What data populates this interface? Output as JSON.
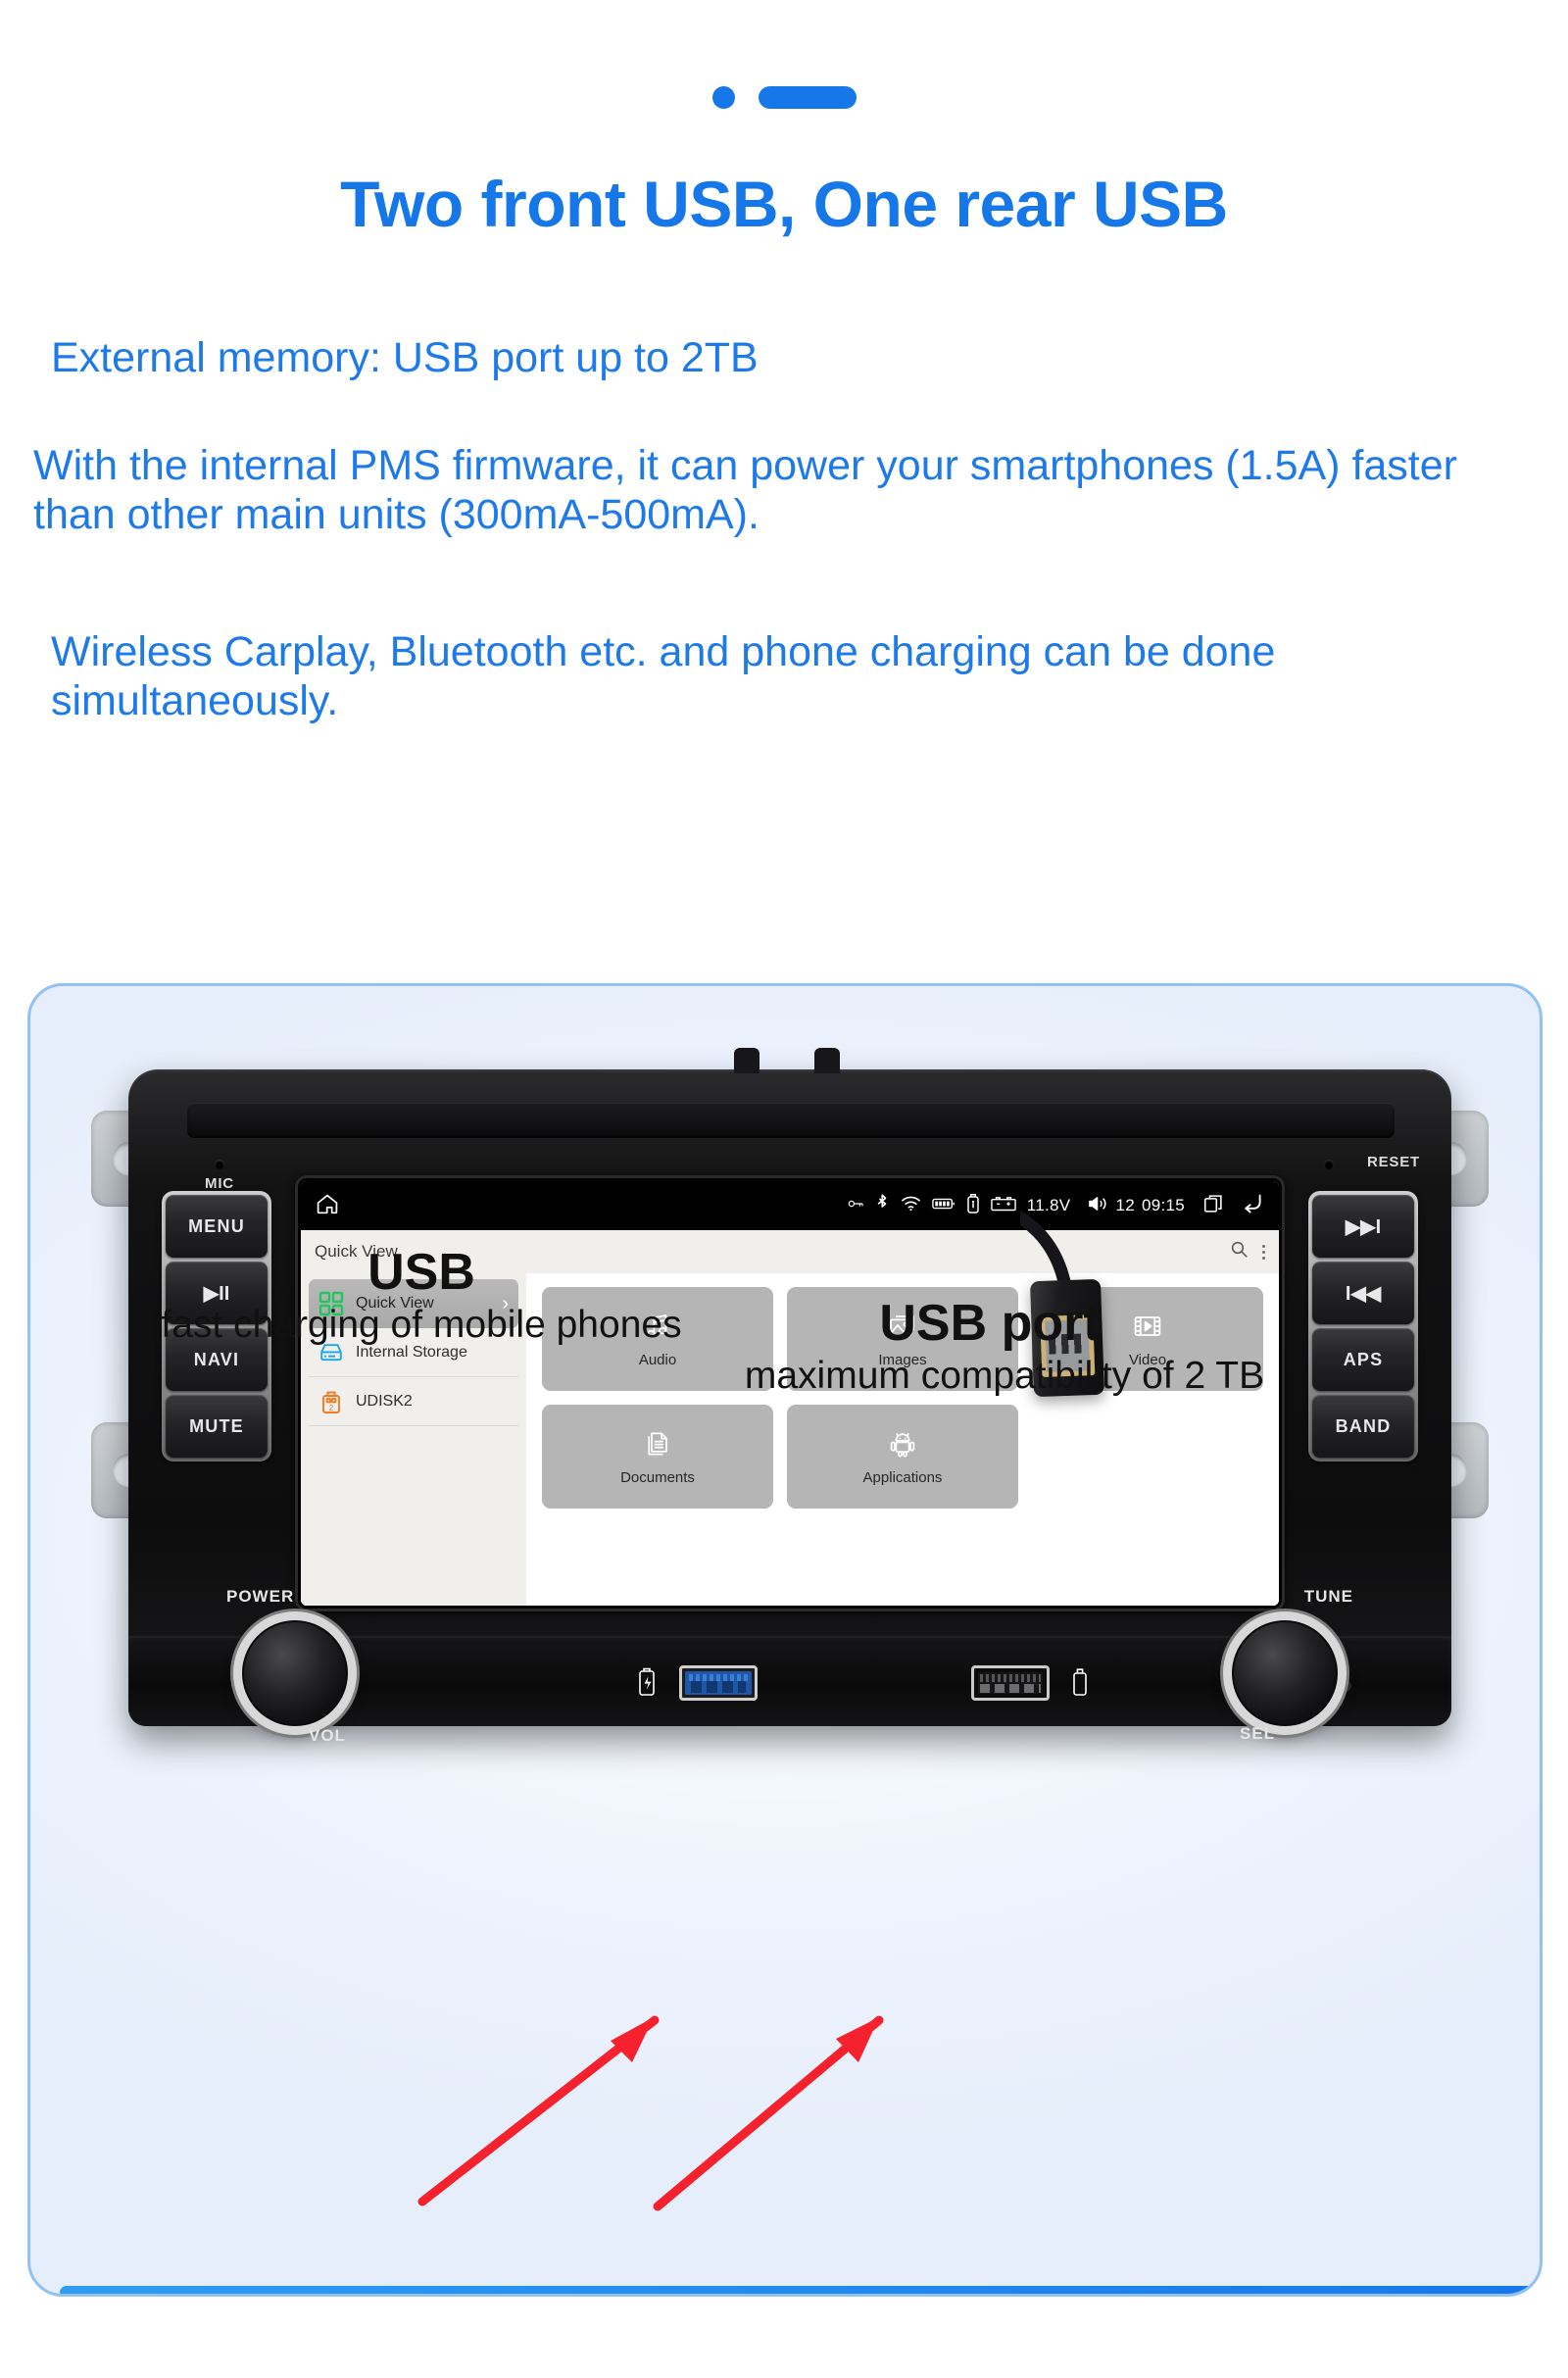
{
  "decoration": {
    "dot": "blue-dot",
    "bar": "blue-bar"
  },
  "headline": "Two front USB, One rear USB",
  "paragraphs": {
    "p1": "External memory: USB port up to 2TB",
    "p2": "With the internal PMS firmware, it can power your smartphones (1.5A) faster than other main units (300mA-500mA).",
    "p3": "Wireless Carplay, Bluetooth etc. and phone charging can be done simultaneously."
  },
  "colors": {
    "accent_blue": "#1577e8",
    "copy_blue": "#1e7ae8",
    "arrow_red": "#f5212d",
    "card_border": "#8fc2f5",
    "tile_gray": "#b5b5b5"
  },
  "head_unit": {
    "mic_label": "MIC",
    "reset_label": "RESET",
    "left_buttons": [
      {
        "label": "MENU",
        "name": "menu-button"
      },
      {
        "label": "▶II",
        "name": "play-pause-button"
      },
      {
        "label": "NAVI",
        "name": "navi-button"
      },
      {
        "label": "MUTE",
        "name": "mute-button"
      }
    ],
    "right_buttons": [
      {
        "label": "▶▶I",
        "name": "next-track-button"
      },
      {
        "label": "I◀◀",
        "name": "previous-track-button"
      },
      {
        "label": "APS",
        "name": "aps-button"
      },
      {
        "label": "BAND",
        "name": "band-button"
      }
    ],
    "knobs": {
      "left_top_label": "POWER",
      "left_bottom_label": "VOL",
      "right_top_label": "TUNE",
      "right_bottom_label": "SEL"
    }
  },
  "screen": {
    "statusbar": {
      "home_icon": "home-icon",
      "icons": [
        "key-icon",
        "bluetooth-icon",
        "wifi-icon",
        "battery-icon",
        "usb-drive-icon",
        "car-battery-icon"
      ],
      "voltage": "11.8V",
      "volume_icon": "volume-icon",
      "volume_level": "12",
      "time": "09:15",
      "recents_icon": "recents-icon",
      "back_icon": "back-icon"
    },
    "file_manager": {
      "title": "Quick View",
      "search_icon": "search-icon",
      "overflow_icon": "overflow-menu-icon",
      "sidebar": [
        {
          "label": "Quick View",
          "icon": "grid-icon",
          "active": true
        },
        {
          "label": "Internal Storage",
          "icon": "internal-storage-icon",
          "active": false
        },
        {
          "label": "UDISK2",
          "icon": "usb-disk-icon",
          "active": false
        }
      ],
      "tiles": [
        {
          "label": "Audio",
          "icon": "music-note-icon"
        },
        {
          "label": "Images",
          "icon": "image-icon"
        },
        {
          "label": "Video",
          "icon": "video-icon"
        },
        {
          "label": "Documents",
          "icon": "documents-icon"
        },
        {
          "label": "Applications",
          "icon": "android-icon"
        }
      ]
    }
  },
  "callouts": {
    "usb_title": "USB",
    "usb_subtitle": "fast charging of mobile phones",
    "port_title": "USB port",
    "port_subtitle": "maximum compatibility of 2 TB"
  }
}
